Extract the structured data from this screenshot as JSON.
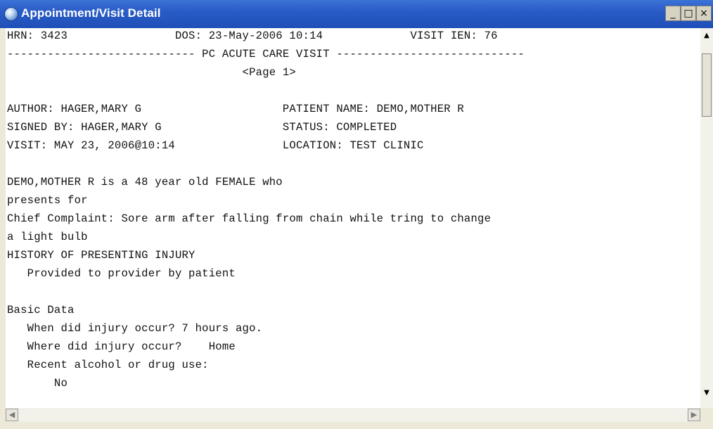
{
  "window": {
    "title": "Appointment/Visit Detail",
    "icons": {
      "app": "app-globe-icon",
      "minimize": "minimize-icon",
      "maximize": "maximize-icon",
      "close": "close-icon"
    },
    "controls": {
      "minimize": "_",
      "maximize": "□",
      "close": "×"
    }
  },
  "colors": {
    "titlebar": "#2a5cc7",
    "text": "#111111",
    "background": "#ffffff"
  },
  "document": {
    "lines": [
      "HRN: 3423                DOS: 23-May-2006 10:14             VISIT IEN: 76",
      "---------------------------- PC ACUTE CARE VISIT ----------------------------",
      "                                   <Page 1>",
      "",
      "AUTHOR: HAGER,MARY G                     PATIENT NAME: DEMO,MOTHER R",
      "SIGNED BY: HAGER,MARY G                  STATUS: COMPLETED",
      "VISIT: MAY 23, 2006@10:14                LOCATION: TEST CLINIC",
      "",
      "DEMO,MOTHER R is a 48 year old FEMALE who",
      "presents for",
      "Chief Complaint: Sore arm after falling from chain while tring to change",
      "a light bulb",
      "HISTORY OF PRESENTING INJURY",
      "   Provided to provider by patient",
      "",
      "Basic Data",
      "   When did injury occur? 7 hours ago.",
      "   Where did injury occur?    Home",
      "   Recent alcohol or drug use:",
      "       No"
    ]
  },
  "scrollbars": {
    "up": "▲",
    "down": "▼",
    "left": "◀",
    "right": "▶"
  }
}
